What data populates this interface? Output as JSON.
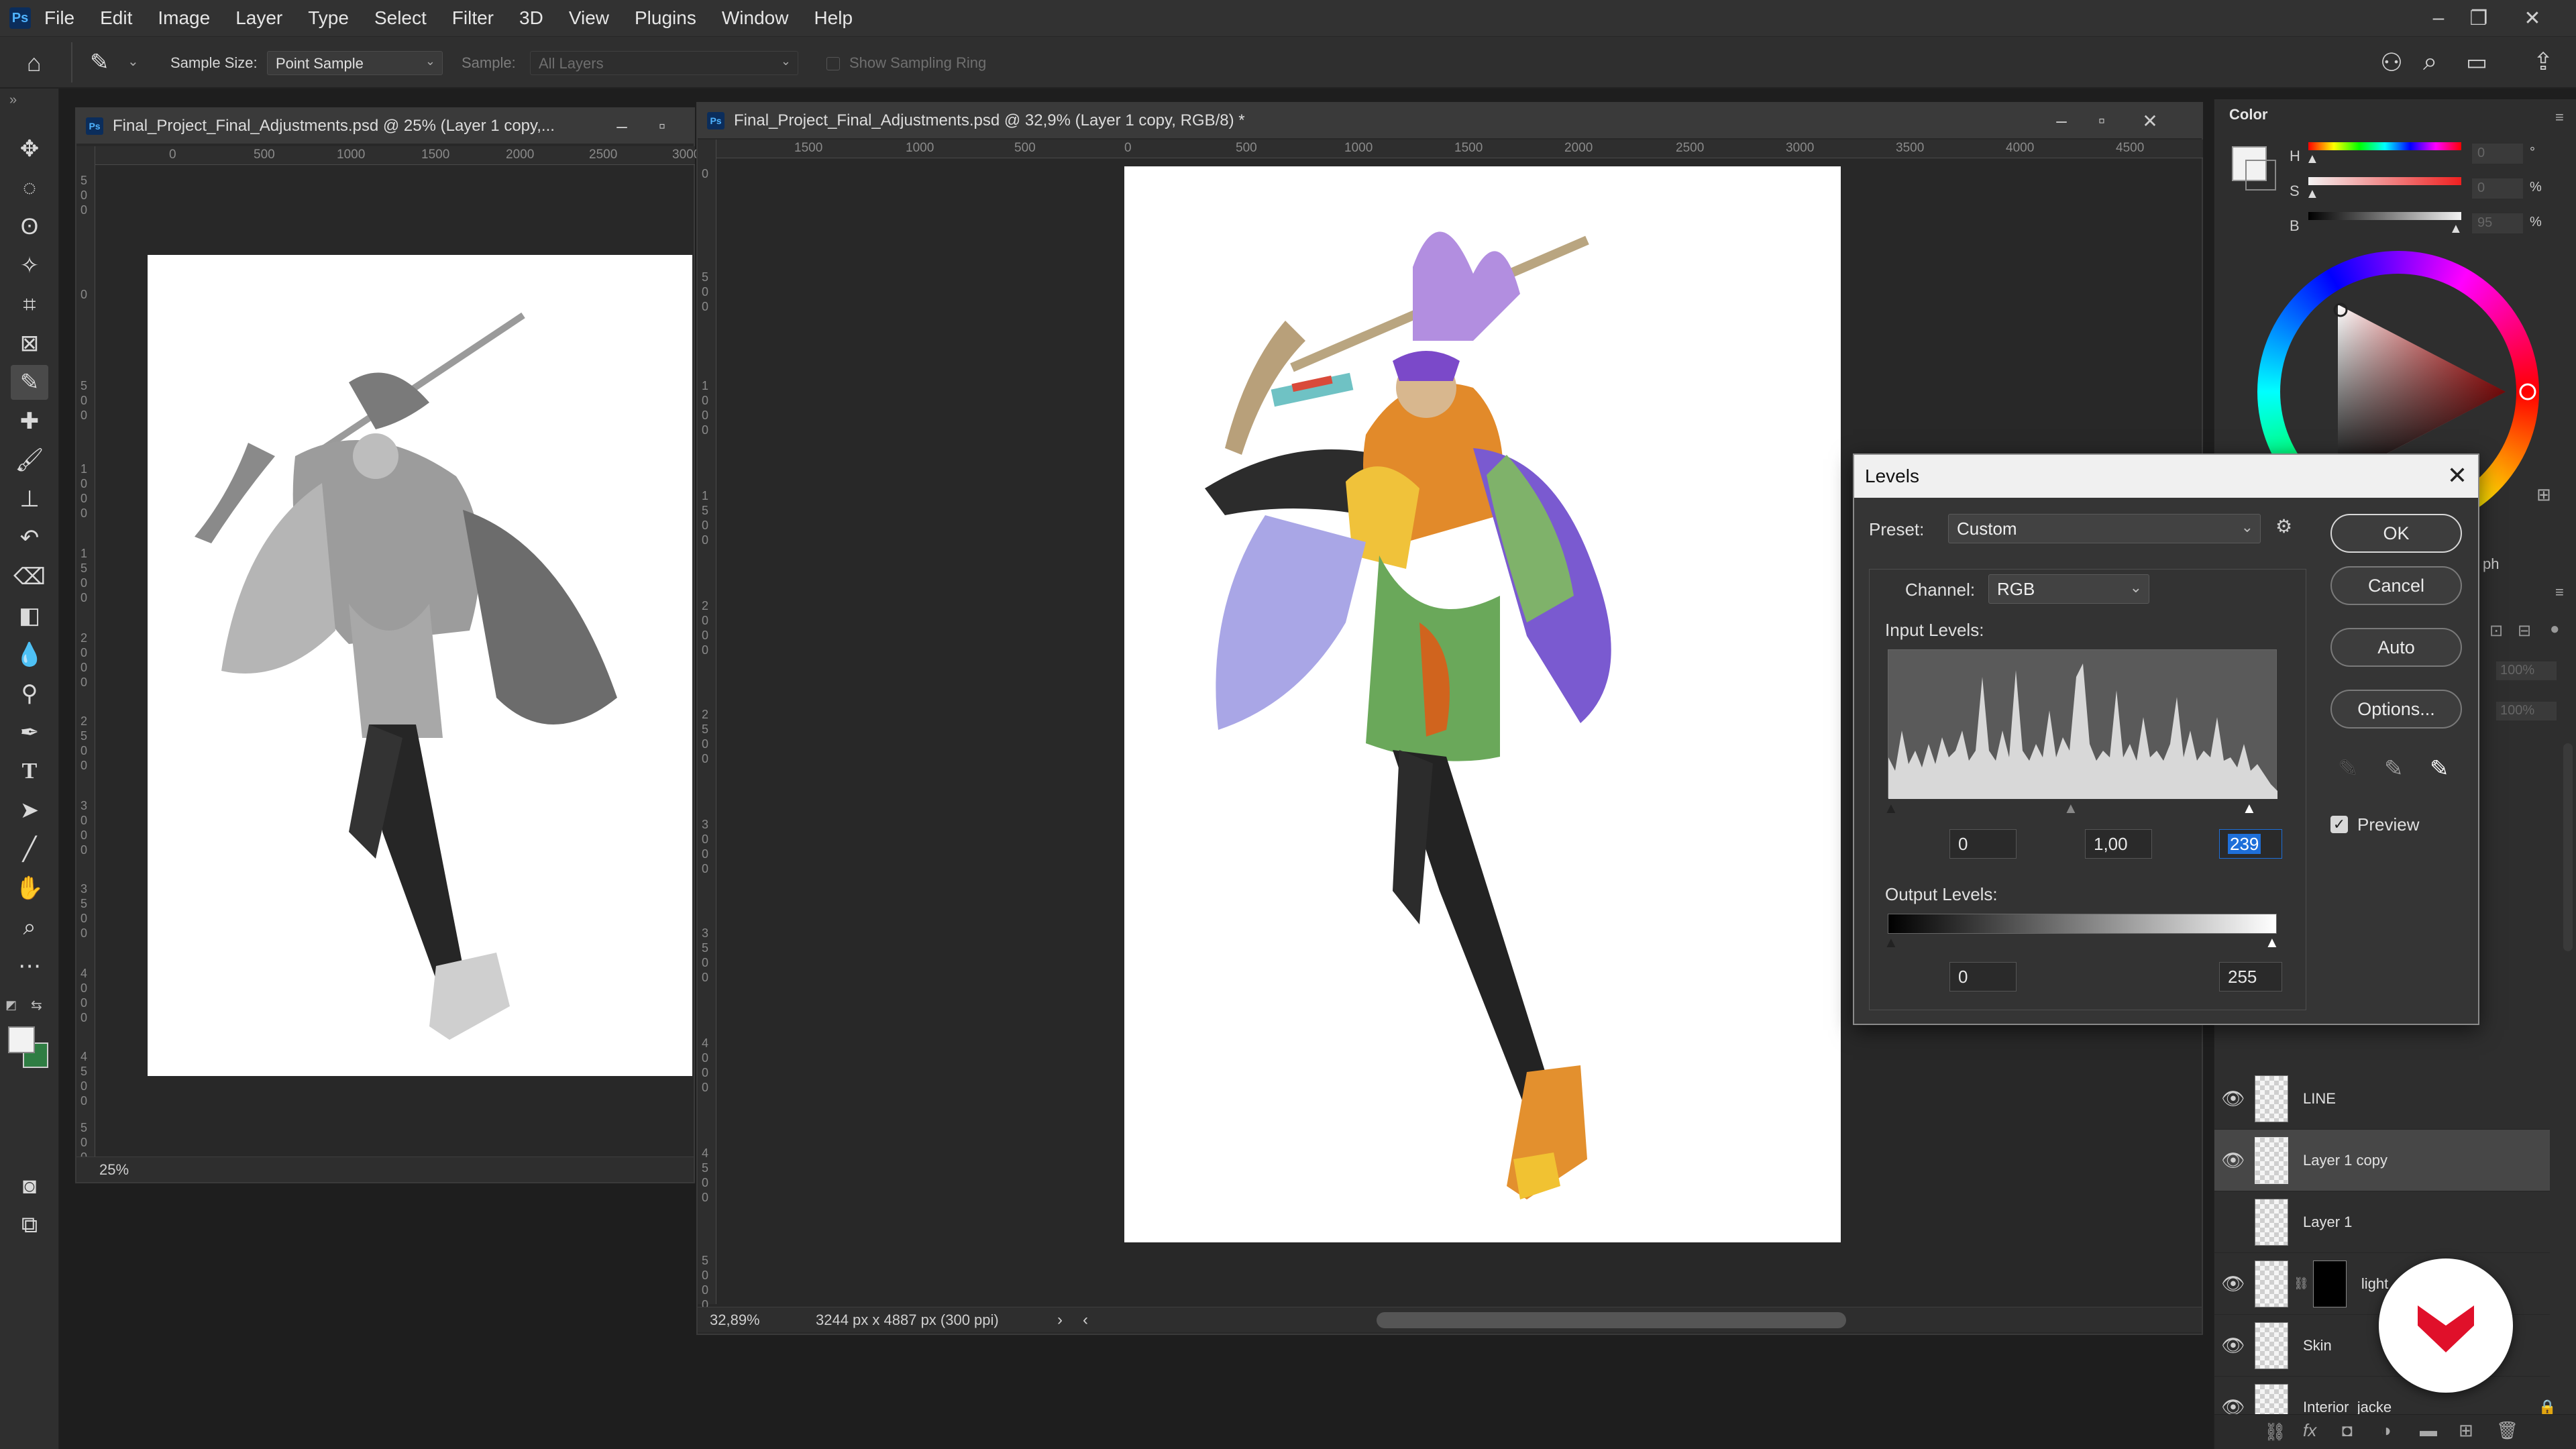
{
  "menubar": {
    "logo": "Ps",
    "items": [
      "File",
      "Edit",
      "Image",
      "Layer",
      "Type",
      "Select",
      "Filter",
      "3D",
      "View",
      "Plugins",
      "Window",
      "Help"
    ]
  },
  "options_bar": {
    "sample_size_label": "Sample Size:",
    "sample_size_value": "Point Sample",
    "sample_label": "Sample:",
    "sample_value": "All Layers",
    "sampling_ring_label": "Show Sampling Ring"
  },
  "doc_left": {
    "title": "Final_Project_Final_Adjustments.psd @ 25% (Layer 1 copy,...",
    "zoom": "25%",
    "ruler_h": [
      "0",
      "500",
      "1000",
      "1500",
      "2000",
      "2500",
      "3000"
    ],
    "ruler_v": [
      "500",
      "0",
      "500",
      "1000",
      "1500",
      "2000",
      "2500",
      "3000",
      "3500",
      "4000",
      "4500",
      "5000"
    ]
  },
  "doc_main": {
    "title": "Final_Project_Final_Adjustments.psd @ 32,9% (Layer 1 copy, RGB/8) *",
    "zoom": "32,89%",
    "doc_info": "3244 px x 4887 px (300 ppi)",
    "ruler_h": [
      "1500",
      "1000",
      "500",
      "0",
      "500",
      "1000",
      "1500",
      "2000",
      "2500",
      "3000",
      "3500",
      "4000",
      "4500"
    ],
    "ruler_v": [
      "0",
      "500",
      "1000",
      "1500",
      "2000",
      "2500",
      "3000",
      "3500",
      "4000",
      "4500",
      "5000"
    ]
  },
  "color_panel": {
    "tab": "Color",
    "sliders": [
      {
        "label": "H",
        "value": "0",
        "unit": "°"
      },
      {
        "label": "S",
        "value": "0",
        "unit": "%"
      },
      {
        "label": "B",
        "value": "95",
        "unit": "%"
      }
    ]
  },
  "layers": [
    {
      "name": "LINE",
      "visible": true,
      "selected": false
    },
    {
      "name": "Layer 1 copy",
      "visible": true,
      "selected": true
    },
    {
      "name": "Layer 1",
      "visible": false,
      "selected": false
    },
    {
      "name": "light",
      "visible": true,
      "selected": false
    },
    {
      "name": "Skin",
      "visible": true,
      "selected": false
    },
    {
      "name": "Interior_jacke",
      "visible": true,
      "selected": false
    }
  ],
  "levels": {
    "title": "Levels",
    "preset_label": "Preset:",
    "preset_value": "Custom",
    "channel_label": "Channel:",
    "channel_value": "RGB",
    "input_label": "Input Levels:",
    "input_black": "0",
    "input_gamma": "1,00",
    "input_white": "239",
    "output_label": "Output Levels:",
    "output_black": "0",
    "output_white": "255",
    "buttons": {
      "ok": "OK",
      "cancel": "Cancel",
      "auto": "Auto",
      "options": "Options..."
    },
    "preview_label": "Preview",
    "preview_checked": true
  },
  "colors": {
    "accent_blue": "#1e6fd9",
    "panel_bg": "#2e2e2e",
    "app_bg": "#1e1e1e",
    "logo_red": "#e0102a"
  }
}
